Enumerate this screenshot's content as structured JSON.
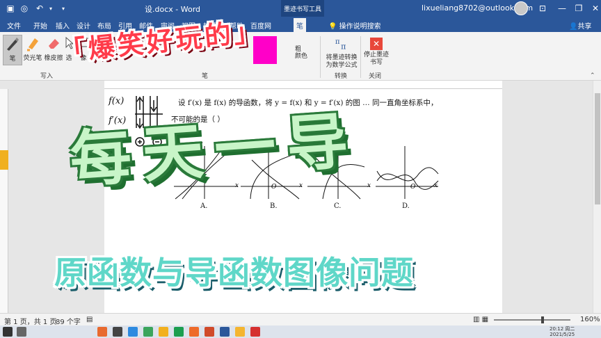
{
  "window": {
    "doc_title": "设.docx  -  Word",
    "context_tab": "墨迹书写工具",
    "user": "lixueliang8702@outlook.com"
  },
  "tabs": [
    "文件",
    "开始",
    "插入",
    "设计",
    "布局",
    "引用",
    "邮件",
    "审阅",
    "视图",
    "加载项",
    "帮助",
    "百度网",
    "笔"
  ],
  "tell_me": "操作说明搜索",
  "share": "共享",
  "ribbon": {
    "tools": [
      "笔",
      "荧光笔",
      "橡皮擦",
      "选",
      "像"
    ],
    "group_write": "写入",
    "group_pen": "笔",
    "color_label": "颜色",
    "thickness_label": "粗",
    "convert_label": "将墨迹转换为数学公式",
    "convert_group": "转换",
    "stop_label": "停止墨迹书写",
    "close_group": "关闭"
  },
  "document": {
    "question_line1": "设 f′(x) 是 f(x) 的导函数，将 y = f(x) 和 y = f′(x) 的图 … 同一直角坐标系中，",
    "question_line2": "不可能的是（     ）",
    "options": [
      "A.",
      "B.",
      "C.",
      "D."
    ],
    "axis_x": "x",
    "axis_y": "y",
    "origin": "O",
    "ink_notes": [
      "f(x)",
      "f′(x)"
    ]
  },
  "overlay": {
    "top": "「爆笑好玩的」",
    "big": "每天一导",
    "sub": "原函数与导函数图像问题"
  },
  "status": {
    "page": "第 1 页，共 1 页",
    "words": "89 个字",
    "zoom": "160%"
  },
  "taskbar": {
    "time": "20:12 周二",
    "date": "2021/5/25"
  },
  "colors": {
    "word_blue": "#2b579a",
    "overlay_red": "#ff3b4a",
    "overlay_green": "#c8f5c8",
    "overlay_teal": "#5fd7c8",
    "ink_swatch": "#ff00c8"
  }
}
